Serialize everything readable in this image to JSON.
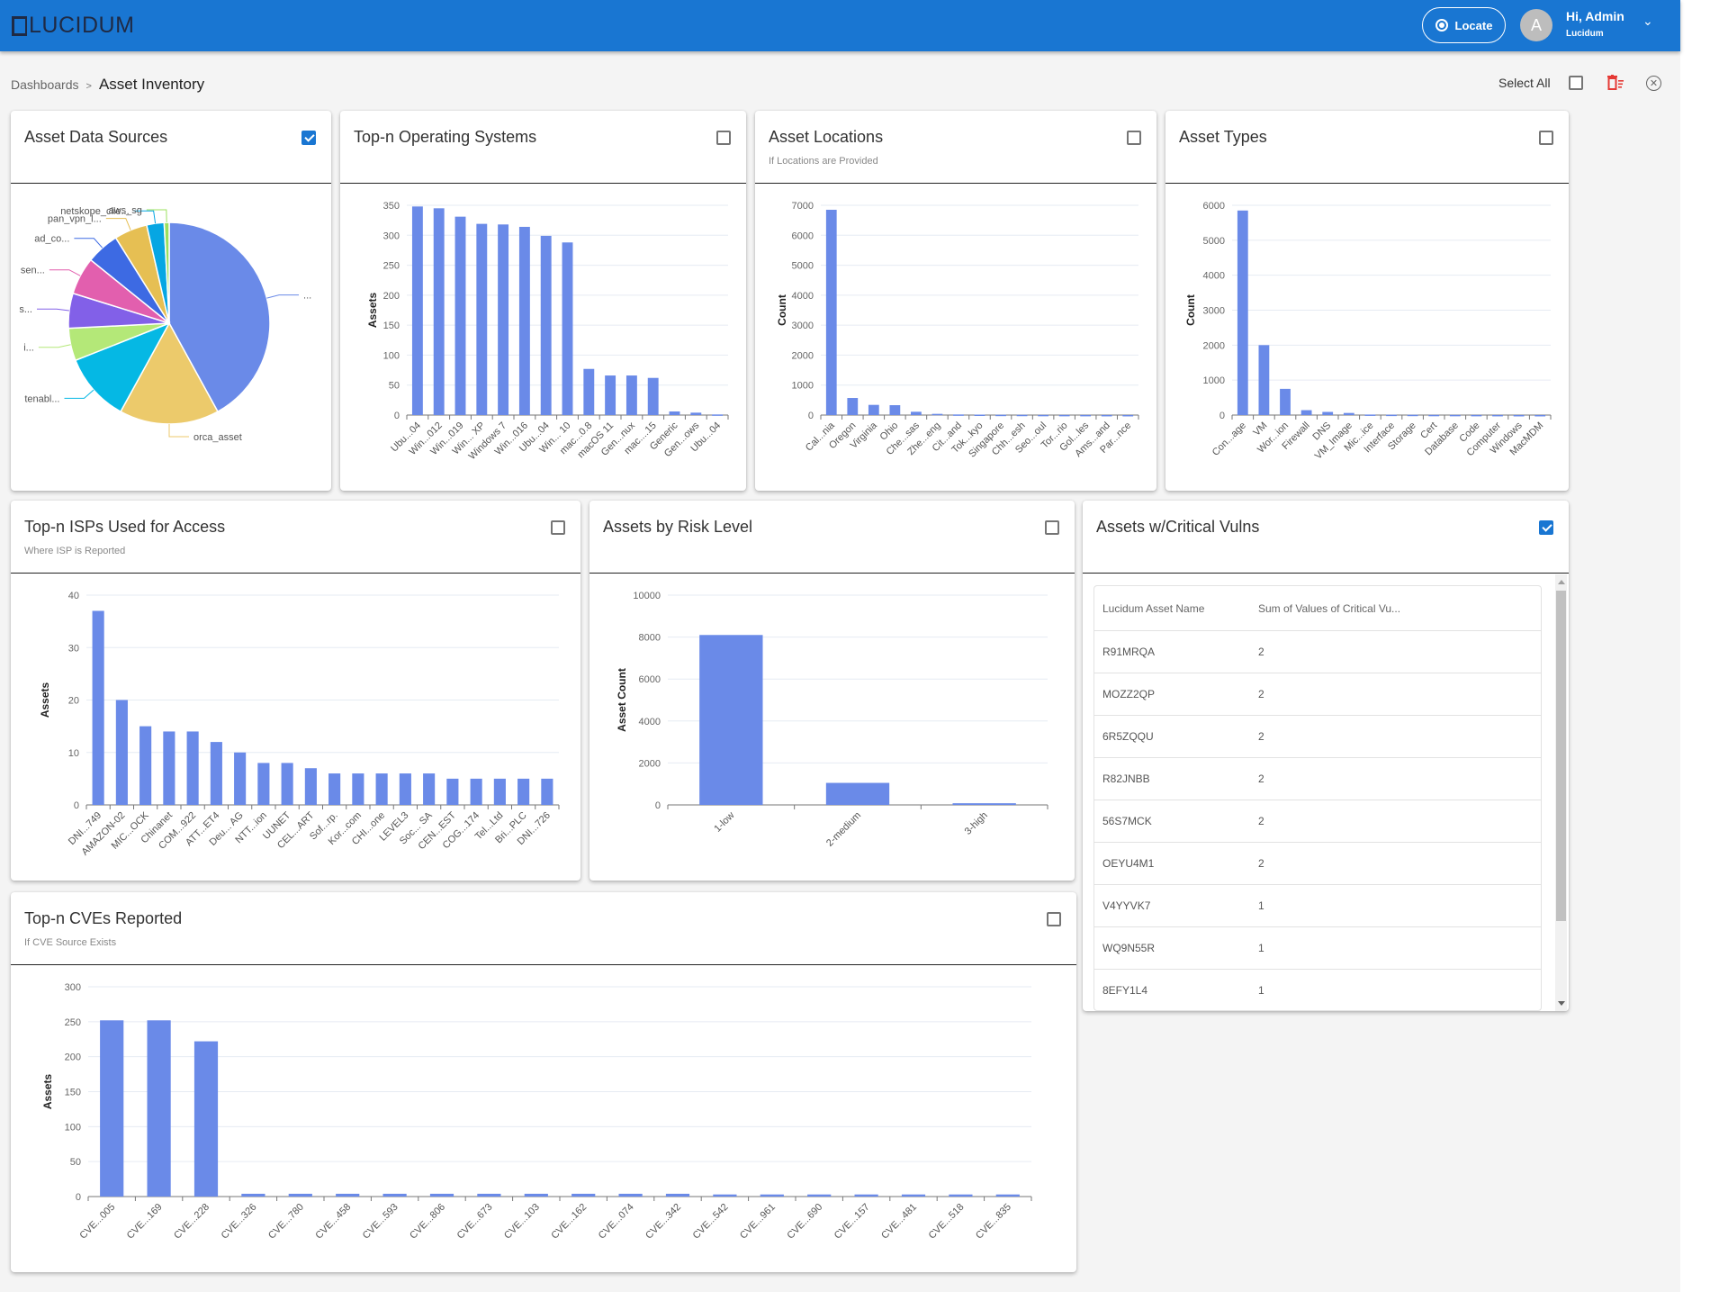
{
  "header": {
    "logo_text": "LUCIDUM",
    "locate_label": "Locate",
    "avatar_initial": "A",
    "user_greeting": "Hi, Admin",
    "user_org": "Lucidum"
  },
  "breadcrumb": {
    "root": "Dashboards",
    "separator": ">",
    "current": "Asset Inventory"
  },
  "toolbar": {
    "select_all_label": "Select All",
    "select_all_checked": false
  },
  "colors": {
    "header_bg": "#1976d2",
    "bar": "#6a8ae8",
    "checkbox_checked": "#1976d2",
    "delete_icon": "#e53935"
  },
  "cards": {
    "data_sources": {
      "title": "Asset Data Sources",
      "subtitle": "",
      "checked": true
    },
    "os": {
      "title": "Top-n Operating Systems",
      "subtitle": "",
      "checked": false
    },
    "locations": {
      "title": "Asset Locations",
      "subtitle": "If Locations are Provided",
      "checked": false
    },
    "types": {
      "title": "Asset Types",
      "subtitle": "",
      "checked": false
    },
    "isps": {
      "title": "Top-n ISPs Used for Access",
      "subtitle": "Where ISP is Reported",
      "checked": false
    },
    "risk": {
      "title": "Assets by Risk Level",
      "subtitle": "",
      "checked": false
    },
    "critical": {
      "title": "Assets w/Critical Vulns",
      "subtitle": "",
      "checked": true
    },
    "cves": {
      "title": "Top-n CVEs Reported",
      "subtitle": "If CVE Source Exists",
      "checked": false
    }
  },
  "critical_table": {
    "columns": [
      "Lucidum Asset Name",
      "Sum of Values of Critical Vu..."
    ],
    "rows": [
      [
        "R91MRQA",
        "2"
      ],
      [
        "MOZZ2QP",
        "2"
      ],
      [
        "6R5ZQQU",
        "2"
      ],
      [
        "R82JNBB",
        "2"
      ],
      [
        "56S7MCK",
        "2"
      ],
      [
        "OEYU4M1",
        "2"
      ],
      [
        "V4YYVK7",
        "1"
      ],
      [
        "WQ9N55R",
        "1"
      ],
      [
        "8EFY1L4",
        "1"
      ]
    ]
  },
  "chart_data": [
    {
      "id": "data_sources",
      "type": "pie",
      "title": "Asset Data Sources",
      "slices": [
        {
          "label": "...",
          "value": 42.0,
          "color": "#6a8ae8"
        },
        {
          "label": "orca_asset",
          "value": 16.0,
          "color": "#ecca6b"
        },
        {
          "label": "tenabl...",
          "value": 11.0,
          "color": "#05b8e4"
        },
        {
          "label": "i...",
          "value": 5.2,
          "color": "#b4e878"
        },
        {
          "label": "s...",
          "value": 5.6,
          "color": "#8260e8"
        },
        {
          "label": "sen...",
          "value": 6.0,
          "color": "#e25fae"
        },
        {
          "label": "ad_co...",
          "value": 5.3,
          "color": "#3d6ae3"
        },
        {
          "label": "pan_vpn_l...",
          "value": 5.3,
          "color": "#e6bf53"
        },
        {
          "label": "netskope_clie...",
          "value": 2.8,
          "color": "#06a6e3"
        },
        {
          "label": "aws_sg",
          "value": 0.8,
          "color": "#9be05e"
        }
      ]
    },
    {
      "id": "os",
      "type": "bar",
      "title": "Top-n Operating Systems",
      "xlabel": "",
      "ylabel": "Assets",
      "ylim": [
        0,
        350
      ],
      "yticks": [
        0,
        50,
        100,
        150,
        200,
        250,
        300,
        350
      ],
      "categories": [
        "Ubu...04",
        "Win...012",
        "Win...019",
        "Win... XP",
        "Windows 7",
        "Win...016",
        "Ubu...04",
        "Win... 10",
        "mac...0.8",
        "macOS 11",
        "Gen...nux",
        "mac....15",
        "Generic",
        "Gen...ows",
        "Ubu...04"
      ],
      "values": [
        348,
        345,
        331,
        319,
        318,
        314,
        299,
        288,
        77,
        66,
        66,
        62,
        6,
        4,
        1
      ]
    },
    {
      "id": "locations",
      "type": "bar",
      "title": "Asset Locations",
      "xlabel": "",
      "ylabel": "Count",
      "ylim": [
        0,
        7000
      ],
      "yticks": [
        0,
        1000,
        2000,
        3000,
        4000,
        5000,
        6000,
        7000
      ],
      "categories": [
        "Cal...nia",
        "Oregon",
        "Virginia",
        "Ohio",
        "Che...sas",
        "Zhe...eng",
        "Cit...and",
        "Tok...kyo",
        "Singapore",
        "Chh...esh",
        "Seo...oul",
        "Tor...rio",
        "Gol...les",
        "Ams...and",
        "Par...nce"
      ],
      "values": [
        6850,
        570,
        340,
        330,
        110,
        40,
        20,
        15,
        10,
        8,
        5,
        4,
        3,
        2,
        1
      ]
    },
    {
      "id": "types",
      "type": "bar",
      "title": "Asset Types",
      "xlabel": "",
      "ylabel": "Count",
      "ylim": [
        0,
        6000
      ],
      "yticks": [
        0,
        1000,
        2000,
        3000,
        4000,
        5000,
        6000
      ],
      "categories": [
        "Con...age",
        "VM",
        "Wor...ion",
        "Firewall",
        "DNS",
        "VM_Image",
        "Mic...ice",
        "Interface",
        "Storage",
        "Cert",
        "Database",
        "Code",
        "Computer",
        "Windows",
        "MacMDM"
      ],
      "values": [
        5850,
        2000,
        750,
        140,
        90,
        60,
        15,
        10,
        8,
        5,
        4,
        3,
        2,
        1,
        1
      ]
    },
    {
      "id": "isps",
      "type": "bar",
      "title": "Top-n ISPs Used for Access",
      "xlabel": "",
      "ylabel": "Assets",
      "ylim": [
        0,
        40
      ],
      "yticks": [
        0,
        10,
        20,
        30,
        40
      ],
      "categories": [
        "DNI...749",
        "AMAZON-02",
        "MIC...OCK",
        "Chinanet",
        "COM...922",
        "ATT...ET4",
        "Deu... AG",
        "NTT...ion",
        "UUNET",
        "CEL...ART",
        "Sof...rp.",
        "Kor...com",
        "CHI...one",
        "LEVEL3",
        "Soc... SA",
        "CEN...EST",
        "COG...174",
        "Tel...Ltd",
        "Bri...PLC",
        "DNI...726"
      ],
      "values": [
        37,
        20,
        15,
        14,
        14,
        12,
        10,
        8,
        8,
        7,
        6,
        6,
        6,
        6,
        6,
        5,
        5,
        5,
        5,
        5
      ]
    },
    {
      "id": "risk",
      "type": "bar",
      "title": "Assets by Risk Level",
      "xlabel": "",
      "ylabel": "Asset Count",
      "ylim": [
        0,
        10000
      ],
      "yticks": [
        0,
        2000,
        4000,
        6000,
        8000,
        10000
      ],
      "categories": [
        "1-low",
        "2-medium",
        "3-high"
      ],
      "values": [
        8100,
        1050,
        80
      ]
    },
    {
      "id": "cves",
      "type": "bar",
      "title": "Top-n CVEs Reported",
      "xlabel": "",
      "ylabel": "Assets",
      "ylim": [
        0,
        300
      ],
      "yticks": [
        0,
        50,
        100,
        150,
        200,
        250,
        300
      ],
      "categories": [
        "CVE...005",
        "CVE...169",
        "CVE...228",
        "CVE...326",
        "CVE...780",
        "CVE...458",
        "CVE...593",
        "CVE...806",
        "CVE...673",
        "CVE...103",
        "CVE...162",
        "CVE...074",
        "CVE...342",
        "CVE...542",
        "CVE...961",
        "CVE...690",
        "CVE...157",
        "CVE...481",
        "CVE...518",
        "CVE...835"
      ],
      "values": [
        252,
        252,
        222,
        4,
        4,
        4,
        4,
        4,
        4,
        4,
        4,
        4,
        4,
        3,
        3,
        3,
        3,
        3,
        3,
        3
      ]
    }
  ]
}
